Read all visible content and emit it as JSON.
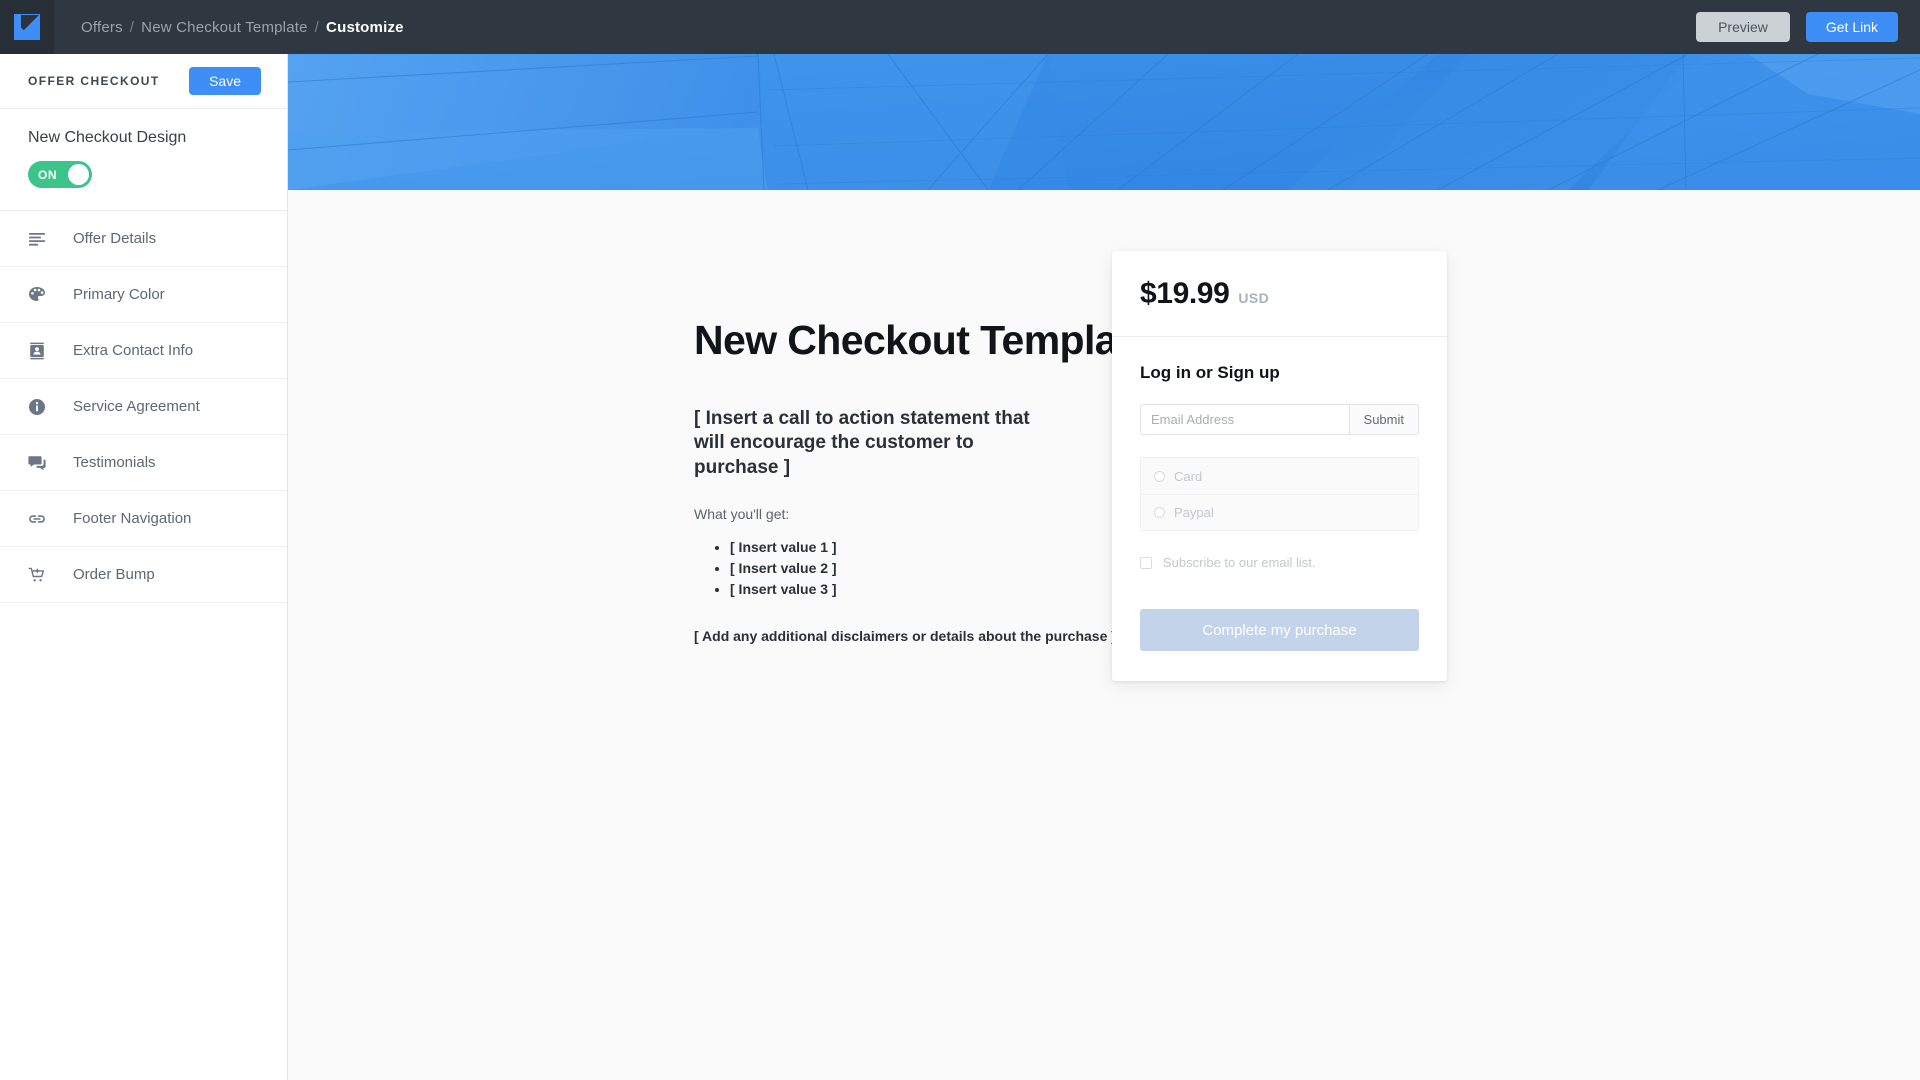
{
  "topbar": {
    "logo_icon": "kajabi-k-logo-icon",
    "breadcrumb": {
      "items": [
        "Offers",
        "New Checkout Template",
        "Customize"
      ],
      "separator": "/"
    },
    "preview_label": "Preview",
    "get_link_label": "Get Link",
    "background_color": "#2f3841",
    "accent_color": "#3d8ef7"
  },
  "sidebar": {
    "title": "OFFER CHECKOUT",
    "save_label": "Save",
    "design_label": "New Checkout Design",
    "toggle_state": "ON",
    "toggle_color": "#3dc48b",
    "items": [
      {
        "label": "Offer Details",
        "icon": "text-lines-icon"
      },
      {
        "label": "Primary Color",
        "icon": "palette-icon"
      },
      {
        "label": "Extra Contact Info",
        "icon": "contact-card-icon"
      },
      {
        "label": "Service Agreement",
        "icon": "info-circle-icon"
      },
      {
        "label": "Testimonials",
        "icon": "chat-bubbles-icon"
      },
      {
        "label": "Footer Navigation",
        "icon": "link-chain-icon"
      },
      {
        "label": "Order Bump",
        "icon": "cart-plus-icon"
      }
    ]
  },
  "preview": {
    "hero_image": "abstract-blue-architecture-banner",
    "hero_color": "#3a8ee6",
    "offer_title": "New Checkout Template",
    "cta_statement": "[ Insert a call to action statement that will encourage the customer to purchase ]",
    "what_you_get_label": "What you'll get:",
    "value_items": [
      "[ Insert value 1 ]",
      "[ Insert value 2 ]",
      "[ Insert value 3 ]"
    ],
    "disclaimer": "[ Add any additional disclaimers or details about the purchase ]"
  },
  "checkout": {
    "price_amount": "$19.99",
    "price_currency": "USD",
    "login_heading": "Log in or Sign up",
    "email_placeholder": "Email Address",
    "email_value": "",
    "submit_label": "Submit",
    "payment_options": [
      "Card",
      "Paypal"
    ],
    "subscribe_label": "Subscribe to our email list.",
    "complete_label": "Complete my purchase",
    "complete_button_color": "#c3d4ea"
  }
}
